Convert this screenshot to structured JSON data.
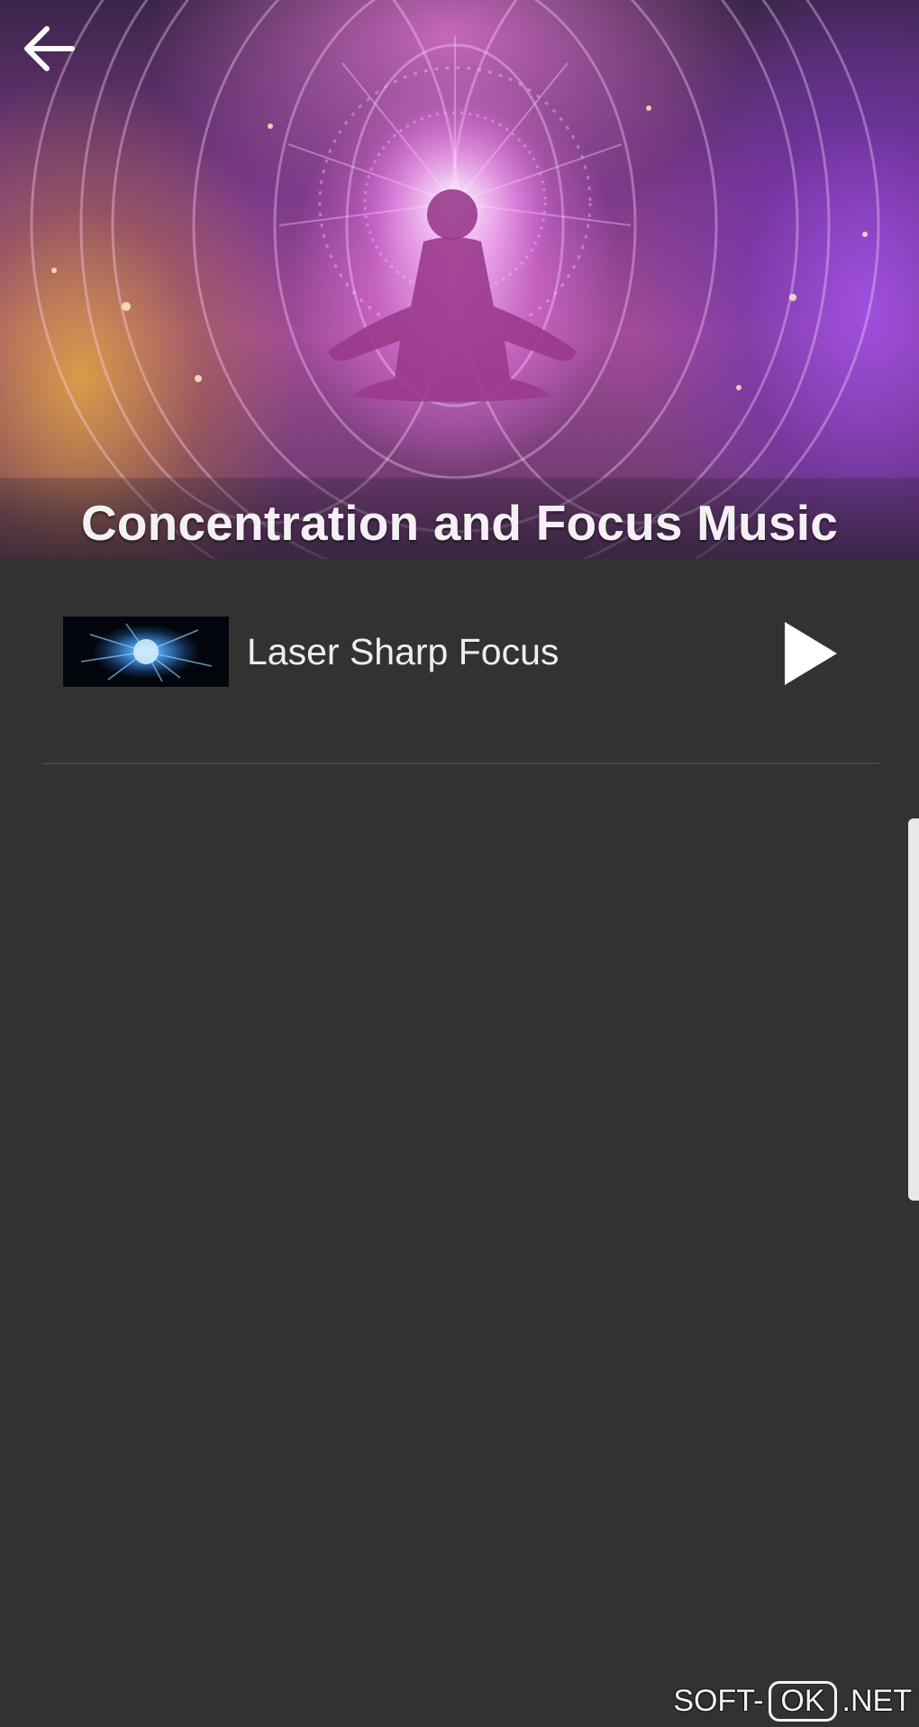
{
  "header": {
    "title": "Concentration and Focus Music",
    "back_icon": "arrow-left-icon",
    "artwork": "meditating-figure-mandala"
  },
  "tracks": [
    {
      "title": "Laser Sharp Focus",
      "thumbnail": "blue-neural-burst",
      "action_icon": "play-icon"
    }
  ],
  "watermark": {
    "left": "SOFT-",
    "box": "OK",
    "right": ".NET"
  },
  "colors": {
    "background": "#323232",
    "divider": "#474747",
    "text": "#eeeeee"
  }
}
